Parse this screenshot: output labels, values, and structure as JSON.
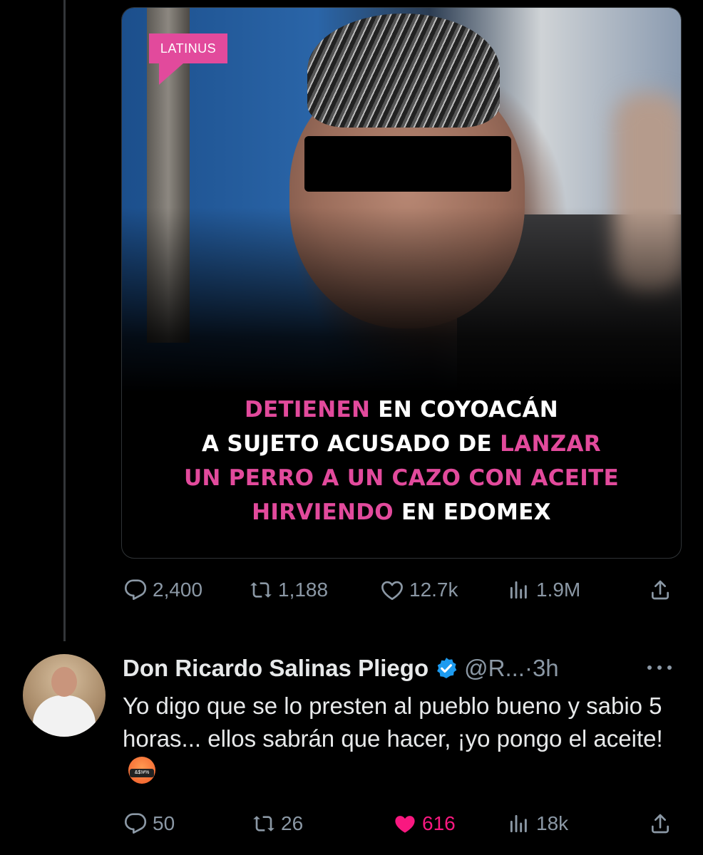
{
  "post": {
    "brand_label": "LATINUS",
    "headline": {
      "line1": [
        {
          "text": "DETIENEN",
          "pink": true
        },
        {
          "text": " EN COYOACÁN",
          "pink": false
        }
      ],
      "line2": [
        {
          "text": "A SUJETO ACUSADO DE ",
          "pink": false
        },
        {
          "text": "LANZAR",
          "pink": true
        }
      ],
      "line3": [
        {
          "text": "UN PERRO A UN CAZO CON ACEITE",
          "pink": true
        }
      ],
      "line4": [
        {
          "text": "HIRVIENDO",
          "pink": true
        },
        {
          "text": " EN EDOMEX",
          "pink": false
        }
      ]
    },
    "actions": {
      "replies": "2,400",
      "reposts": "1,188",
      "likes": "12.7k",
      "views": "1.9M"
    }
  },
  "reply": {
    "name": "Don Ricardo Salinas Pliego",
    "handle": "@R...",
    "dot": "·",
    "time": "3h",
    "text": "Yo digo que se lo presten al pueblo bueno y sabio 5 horas... ellos sabrán que hacer, ¡yo pongo el aceite!",
    "emoji": "enraged-face-with-symbols",
    "actions": {
      "replies": "50",
      "reposts": "26",
      "likes": "616",
      "views": "18k",
      "liked": true
    }
  },
  "colors": {
    "background": "#000000",
    "text": "#e7e9ea",
    "muted": "#8b98a5",
    "like_active": "#f91880",
    "brand_pink": "#e24a9c",
    "verified_blue": "#1d9bf0"
  },
  "icons": [
    "reply-icon",
    "repost-icon",
    "like-icon",
    "views-icon",
    "share-icon",
    "verified-badge-icon",
    "more-icon"
  ]
}
